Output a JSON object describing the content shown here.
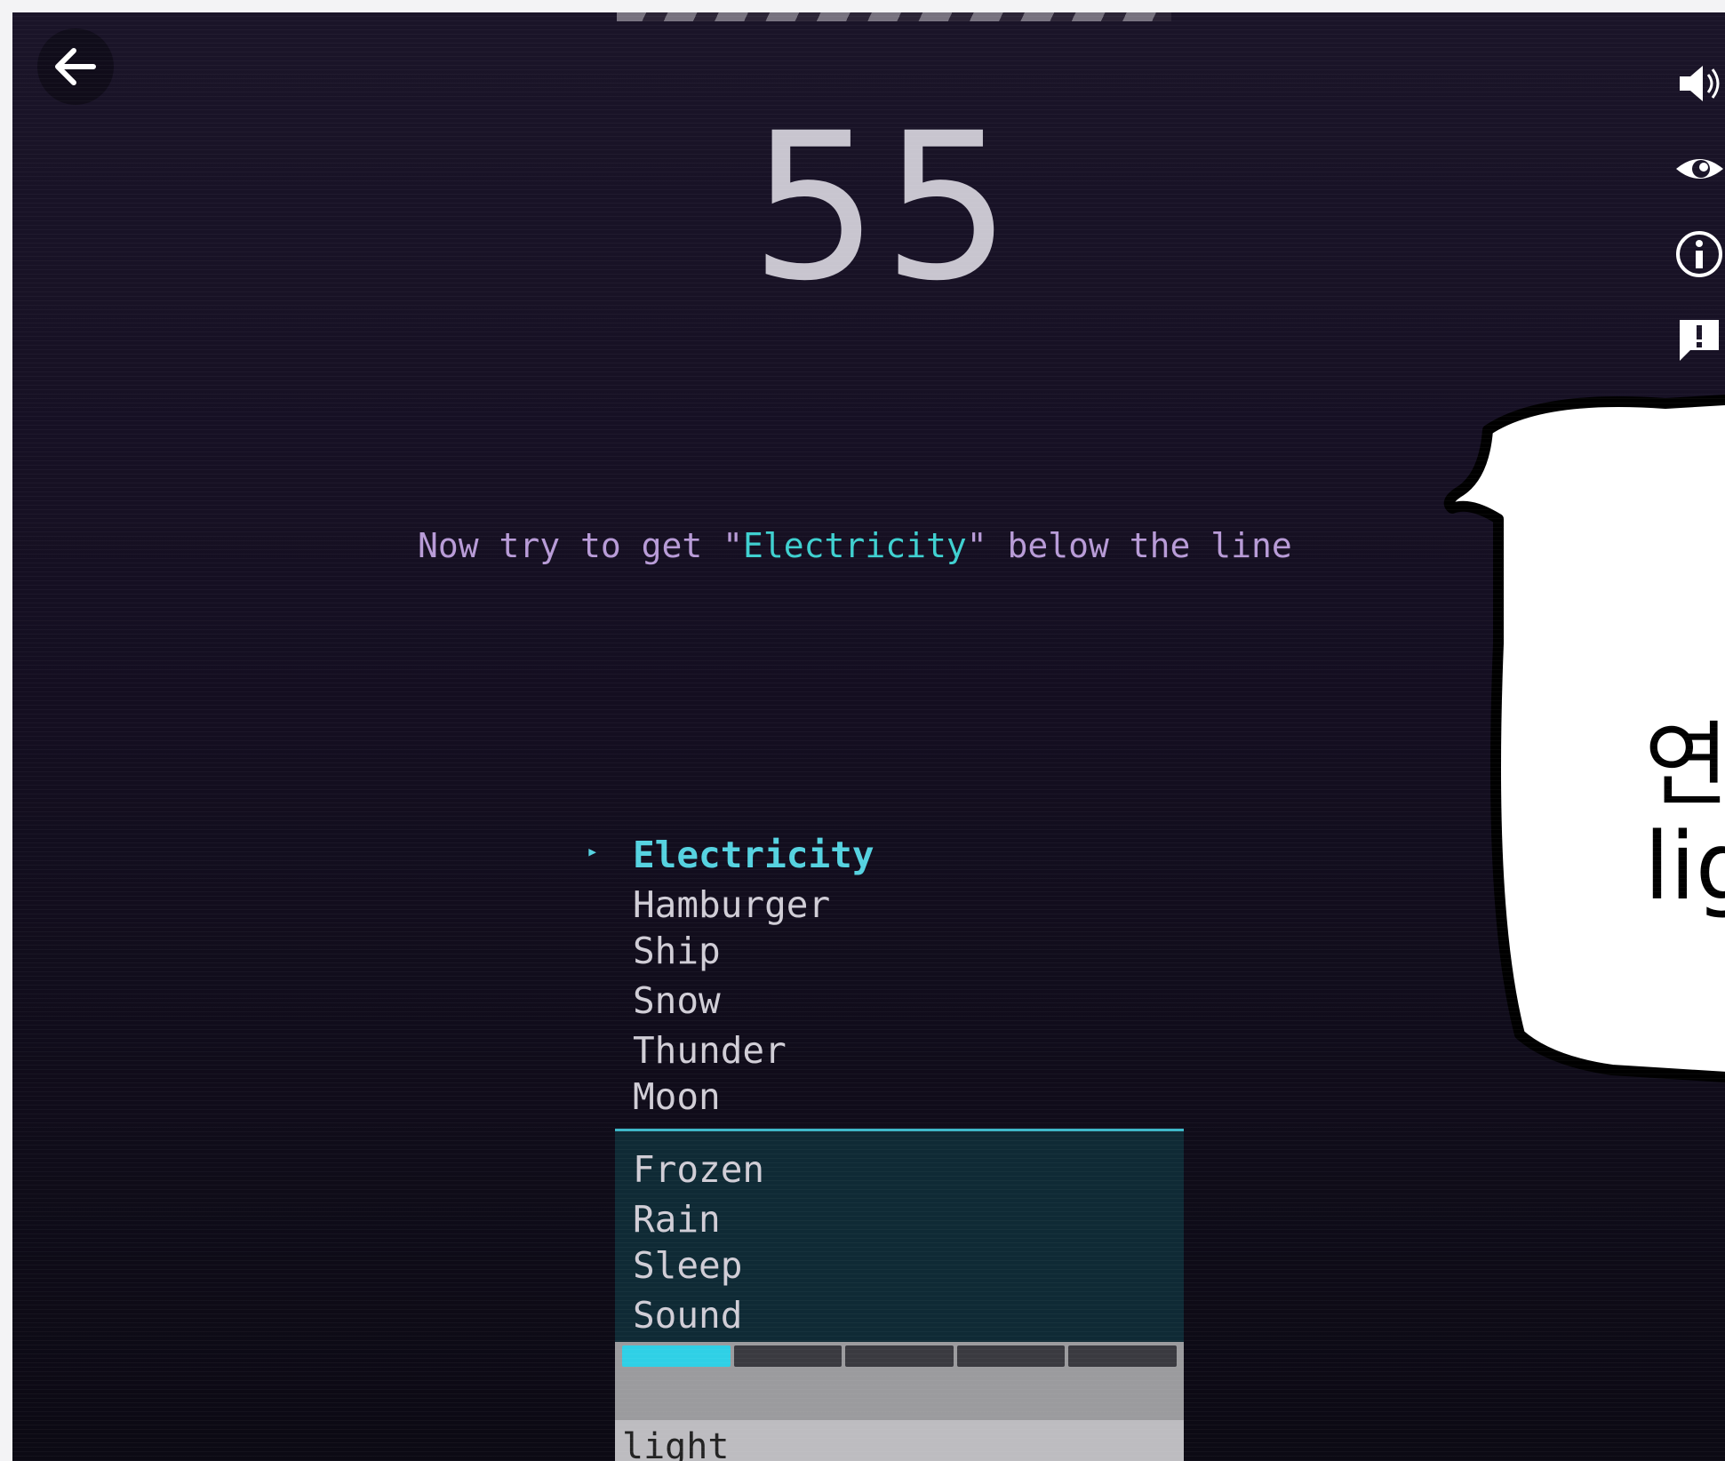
{
  "score": "55",
  "instruction": {
    "prefix": "Now try to get \"",
    "target": "Electricity",
    "suffix": "\" below the line"
  },
  "above_line_words": [
    {
      "label": "Electricity",
      "state": "target"
    },
    {
      "label": "Hamburger"
    },
    {
      "label": "Ship"
    },
    {
      "label": "Snow"
    },
    {
      "label": "Thunder"
    },
    {
      "label": "Moon"
    }
  ],
  "below_line_words": [
    {
      "label": "Frozen"
    },
    {
      "label": "Rain"
    },
    {
      "label": "Sleep"
    },
    {
      "label": "Sound"
    }
  ],
  "progress": {
    "filled": 1,
    "total": 5
  },
  "input": {
    "value": "light"
  },
  "overlay_bubble": {
    "line1": "연",
    "line2": "lig"
  },
  "icons": {
    "back": "arrow-left-icon",
    "side": [
      "speaker-icon",
      "eye-icon",
      "info-icon",
      "report-icon"
    ]
  },
  "colors": {
    "accent": "#3fd0d0",
    "progress_on": "#2fd0e6",
    "instruction": "#b89bd7"
  }
}
